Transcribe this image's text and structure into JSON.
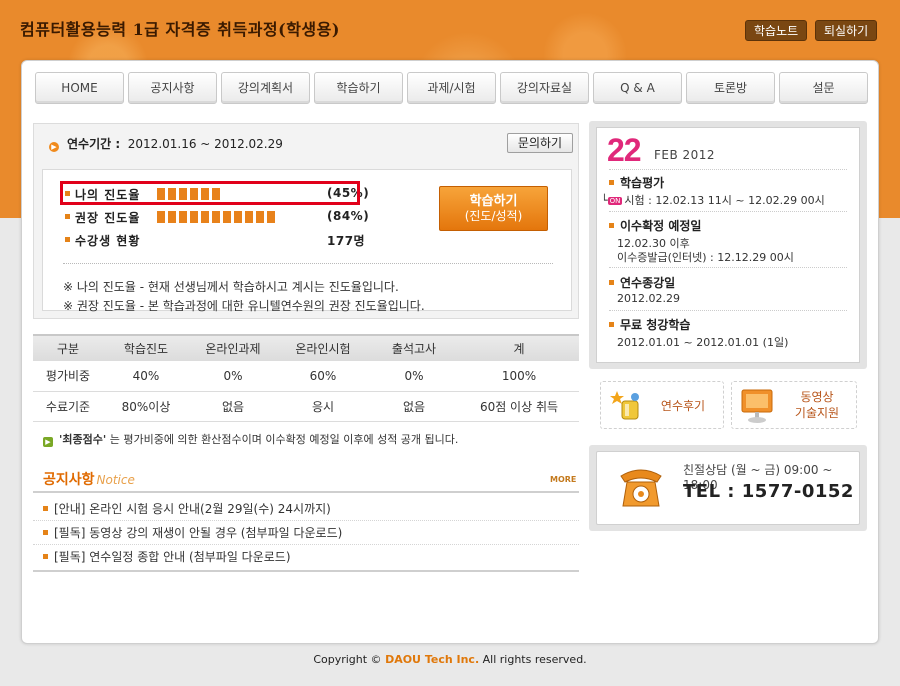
{
  "header": {
    "title": "컴퓨터활용능력 1급 자격증 취득과정(학생용)",
    "study_note_label": "학습노트",
    "logout_label": "퇴실하기"
  },
  "nav": [
    "HOME",
    "공지사항",
    "강의계획서",
    "학습하기",
    "과제/시험",
    "강의자료실",
    "Q & A",
    "토론방",
    "설문"
  ],
  "period": {
    "label": "연수기간 :",
    "range": "2012.01.16 ~ 2012.02.29",
    "inquiry_label": "문의하기"
  },
  "progress": {
    "rows": [
      {
        "label": "나의 진도율",
        "value_text": "(45%)",
        "percent": 45,
        "segments": 6
      },
      {
        "label": "권장 진도율",
        "value_text": "(84%)",
        "percent": 84,
        "segments": 11
      },
      {
        "label": "수강생 현황",
        "value_text": "177명"
      }
    ],
    "study_button": {
      "line1": "학습하기",
      "line2": "(진도/성적)"
    },
    "notes": [
      "※ 나의 진도율 - 현재 선생님께서 학습하시고 계시는 진도율입니다.",
      "※ 권장 진도율 - 본 학습과정에 대한 유니텔연수원의 권장 진도율입니다."
    ]
  },
  "evaluation": {
    "headers": [
      "구분",
      "학습진도",
      "온라인과제",
      "온라인시험",
      "출석고사",
      "계"
    ],
    "rows": [
      [
        "평가비중",
        "40%",
        "0%",
        "60%",
        "0%",
        "100%"
      ],
      [
        "수료기준",
        "80%이상",
        "없음",
        "응시",
        "없음",
        "60점 이상 취득"
      ]
    ],
    "note_bold": "'최종점수'",
    "note_text": "는 평가비중에 의한 환산점수이며 이수확정 예정일 이후에 성적 공개 됩니다."
  },
  "notice": {
    "title": "공지사항",
    "subtitle": "Notice",
    "more_label": "MORE",
    "items": [
      "[안내] 온라인 시험 응시 안내(2월 29일(수) 24시까지)",
      "[필독] 동영상 강의 재생이 안될 경우 (첨부파일 다운로드)",
      "[필독] 연수일정 종합 안내 (첨부파일 다운로드)"
    ]
  },
  "calendar": {
    "day": "22",
    "month_year": "FEB 2012",
    "schedule": [
      {
        "title": "학습평가",
        "tag": "ON",
        "lines": [
          "시험 : 12.02.13 11시 ~ 12.02.29 00시"
        ]
      },
      {
        "title": "이수확정 예정일",
        "lines": [
          "12.02.30 이후",
          "이수증발급(인터넷) : 12.12.29 00시"
        ]
      },
      {
        "title": "연수종강일",
        "lines": [
          "2012.02.29"
        ]
      },
      {
        "title": "무료 청강학습",
        "lines": [
          "2012.01.01 ~ 2012.01.01 (1일)"
        ]
      }
    ]
  },
  "cards": {
    "review_label": "연수후기",
    "video_label_1": "동영상",
    "video_label_2": "기술지원"
  },
  "contact": {
    "hours": "친절상담 (월 ~ 금) 09:00 ~ 18:00",
    "tel": "TEL : 1577-0152"
  },
  "footer": {
    "prefix": "Copyright ©",
    "brand": "DAOU Tech Inc.",
    "suffix": "All rights reserved."
  }
}
